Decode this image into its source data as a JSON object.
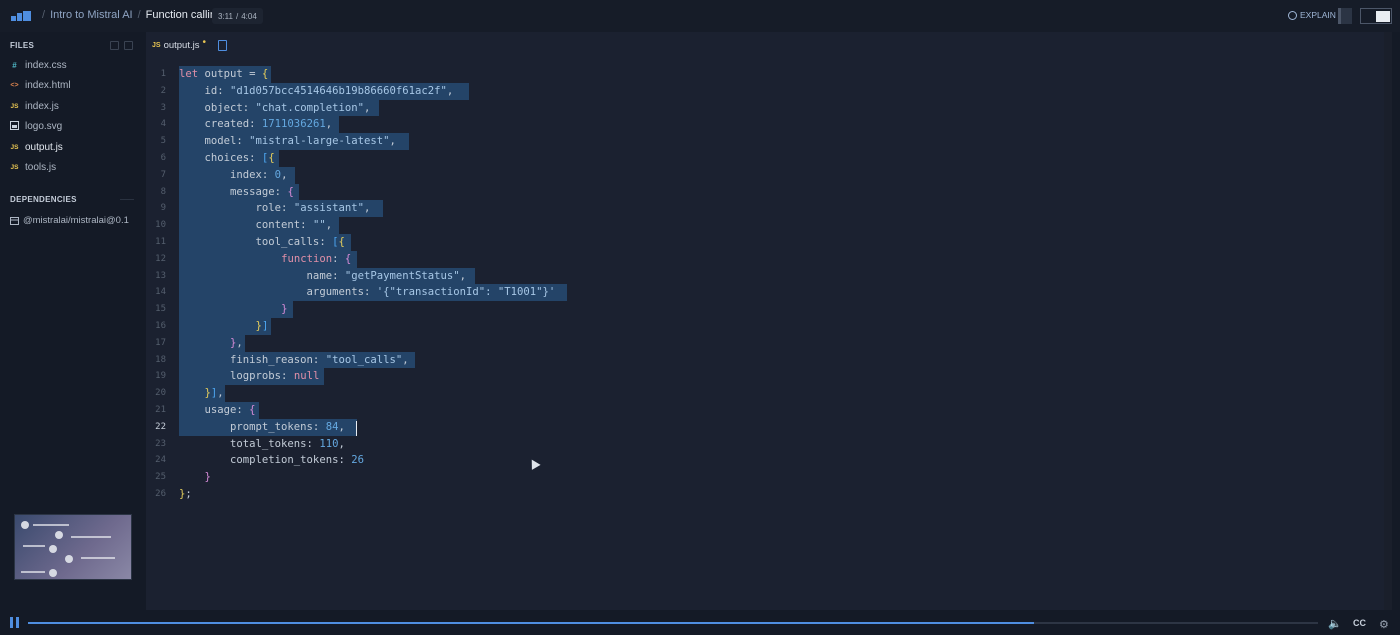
{
  "header": {
    "breadcrumb": [
      "Intro to Mistral AI",
      "Function calling"
    ],
    "time_current": "3:11",
    "time_sep": "/",
    "time_total": "4:04",
    "explain_label": "EXPLAIN"
  },
  "sidebar": {
    "files_title": "FILES",
    "files": [
      {
        "icon": "#",
        "name": "index.css",
        "icon_color": "#4fb7c5"
      },
      {
        "icon": "<>",
        "name": "index.html",
        "icon_color": "#e0864f"
      },
      {
        "icon": "JS",
        "name": "index.js",
        "icon_color": "#e8c552"
      },
      {
        "icon": "img",
        "name": "logo.svg",
        "icon_color": "#c9d1dc"
      },
      {
        "icon": "JS",
        "name": "output.js",
        "icon_color": "#e8c552"
      },
      {
        "icon": "JS",
        "name": "tools.js",
        "icon_color": "#e8c552"
      }
    ],
    "active_file": "output.js",
    "deps_title": "DEPENDENCIES",
    "dependency": "@mistralai/mistralai@0.1"
  },
  "editor": {
    "tab_label": "output.js",
    "tab_modified_marker": "•",
    "current_line": 22,
    "lines": [
      "1",
      "2",
      "3",
      "4",
      "5",
      "6",
      "7",
      "8",
      "9",
      "10",
      "11",
      "12",
      "13",
      "14",
      "15",
      "16",
      "17",
      "18",
      "19",
      "20",
      "21",
      "22",
      "23",
      "24",
      "25",
      "26"
    ],
    "code": {
      "l1a": "let",
      "l1b": " output = ",
      "l1c": "{",
      "l2a": "    id: ",
      "l2b": "\"d1d057bcc4514646b19b86660f61ac2f\"",
      "l2c": ",",
      "l3a": "    object: ",
      "l3b": "\"chat.completion\"",
      "l3c": ",",
      "l4a": "    created: ",
      "l4b": "1711036261",
      "l4c": ",",
      "l5a": "    model: ",
      "l5b": "\"mistral-large-latest\"",
      "l5c": ",",
      "l6a": "    choices: ",
      "l6b": "[",
      "l6c": "{",
      "l7a": "        index: ",
      "l7b": "0",
      "l7c": ",",
      "l8a": "        message: ",
      "l8b": "{",
      "l9a": "            role: ",
      "l9b": "\"assistant\"",
      "l9c": ",",
      "l10a": "            content: ",
      "l10b": "\"\"",
      "l10c": ",",
      "l11a": "            tool_calls: ",
      "l11b": "[",
      "l11c": "{",
      "l12a": "                ",
      "l12b": "function",
      "l12c": ": ",
      "l12d": "{",
      "l13a": "                    name: ",
      "l13b": "\"getPaymentStatus\"",
      "l13c": ",",
      "l14a": "                    arguments: ",
      "l14b": "'{\"transactionId\": \"T1001\"}'",
      "l15a": "                ",
      "l15b": "}",
      "l16a": "            ",
      "l16b": "}",
      "l16c": "]",
      "l17a": "        ",
      "l17b": "}",
      "l17c": ",",
      "l18a": "        finish_reason: ",
      "l18b": "\"tool_calls\"",
      "l18c": ",",
      "l19a": "        logprobs: ",
      "l19b": "null",
      "l20a": "    ",
      "l20b": "}",
      "l20c": "]",
      "l20d": ",",
      "l21a": "    usage: ",
      "l21b": "{",
      "l22a": "        prompt_tokens: ",
      "l22b": "84",
      "l22c": ",",
      "l23a": "        total_tokens: ",
      "l23b": "110",
      "l23c": ",",
      "l24a": "        completion_tokens: ",
      "l24b": "26",
      "l25a": "    ",
      "l25b": "}",
      "l26a": "}",
      "l26b": ";"
    }
  },
  "player": {
    "progress": 0.78,
    "cc_label": "CC"
  }
}
